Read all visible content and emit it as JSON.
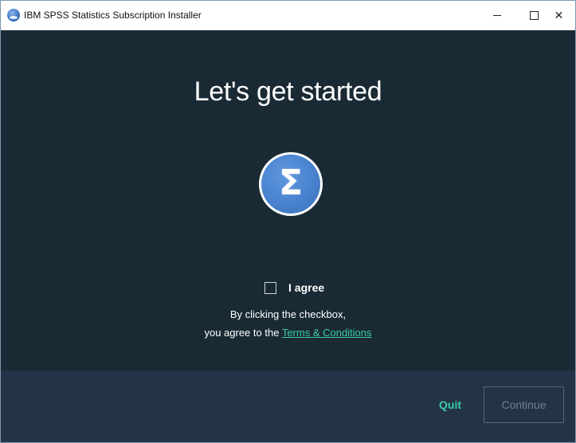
{
  "window": {
    "title": "IBM SPSS Statistics Subscription Installer",
    "controls": {
      "minimize": "minimize",
      "maximize": "maximize",
      "close": "✕"
    }
  },
  "main": {
    "heading": "Let's get started",
    "logo_symbol": "Σ",
    "agree": {
      "checked": false,
      "label": "I agree"
    },
    "description_line1": "By clicking the checkbox,",
    "description_line2_prefix": "you agree to the ",
    "terms_link": "Terms & Conditions"
  },
  "footer": {
    "quit_label": "Quit",
    "continue_label": "Continue",
    "continue_enabled": false
  },
  "colors": {
    "main_bg": "#1a2a35",
    "footer_bg": "#243446",
    "accent": "#3ccaa8",
    "logo_blue": "#4a84d0"
  },
  "icons": {
    "app": "spss-app-icon",
    "logo": "sigma-logo-icon"
  }
}
